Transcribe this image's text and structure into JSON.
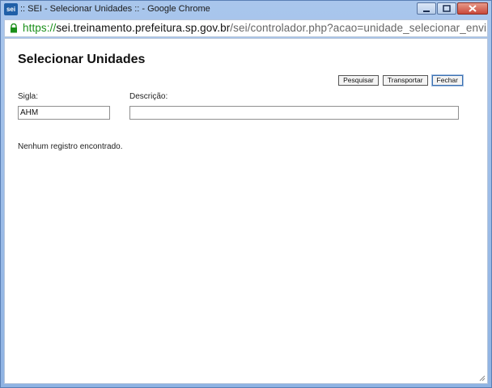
{
  "window": {
    "app_logo": "sei",
    "title": ":: SEI - Selecionar Unidades :: - Google Chrome",
    "buttons": {
      "minimize": "minimize-icon",
      "maximize": "maximize-icon",
      "close": "close-icon"
    }
  },
  "address": {
    "scheme": "https://",
    "host": "sei.treinamento.prefeitura.sp.gov.br",
    "path": "/sei/controlador.php?acao=unidade_selecionar_envi"
  },
  "page": {
    "title": "Selecionar Unidades",
    "toolbar": {
      "search_label": "Pesquisar",
      "transport_label": "Transportar",
      "close_label": "Fechar"
    },
    "sigla": {
      "label": "Sigla:",
      "value": "AHM"
    },
    "descricao": {
      "label": "Descrição:",
      "value": ""
    },
    "message": "Nenhum registro encontrado."
  },
  "colors": {
    "accent": "#1f5fa8",
    "secure": "#1a8f1a",
    "frame": "#8fb3e3"
  }
}
